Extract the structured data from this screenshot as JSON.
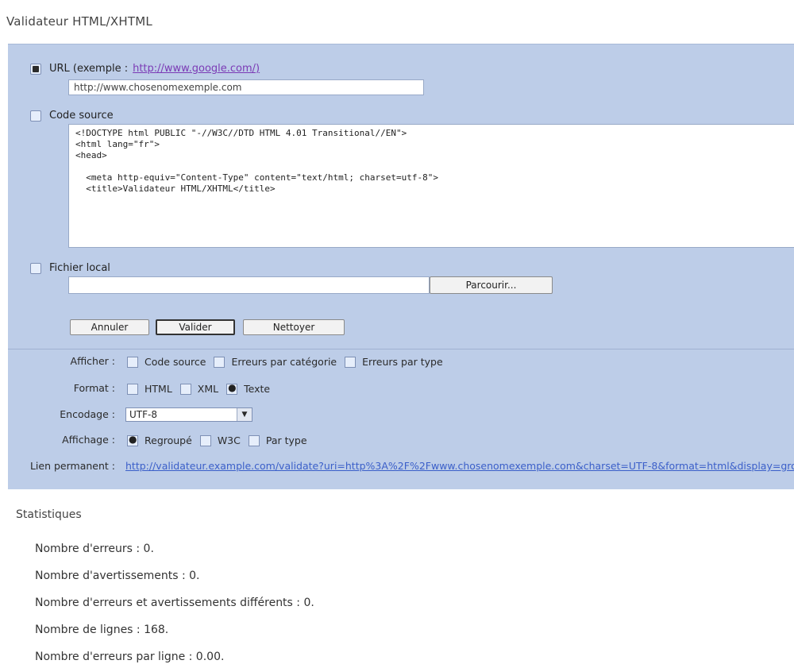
{
  "page": {
    "title": "Validateur HTML/XHTML"
  },
  "url_option": {
    "label": "URL (exemple :",
    "example_link": "http://www.google.com/)",
    "value": "http://www.chosenomexemple.com"
  },
  "source_option": {
    "label": "Code source",
    "code": "<!DOCTYPE html PUBLIC \"-//W3C//DTD HTML 4.01 Transitional//EN\">\n<html lang=\"fr\">\n<head>\n\n  <meta http-equiv=\"Content-Type\" content=\"text/html; charset=utf-8\">\n  <title>Validateur HTML/XHTML</title>"
  },
  "file_option": {
    "label": "Fichier local",
    "browse_label": "Parcourir..."
  },
  "buttons": {
    "cancel": "Annuler",
    "validate": "Valider",
    "clean": "Nettoyer"
  },
  "options": {
    "display_label": "Afficher :",
    "display_items": [
      "Code source",
      "Erreurs par catégorie",
      "Erreurs par type"
    ],
    "format_label": "Format :",
    "format_items": [
      "HTML",
      "XML",
      "Texte"
    ],
    "encoding_label": "Encodage :",
    "encoding_value": "UTF-8",
    "output_label": "Affichage :",
    "output_items": [
      "Regroupé",
      "W3C",
      "Par type"
    ],
    "permalink_label": "Lien permanent :",
    "permalink_value": "http://validateur.example.com/validate?uri=http%3A%2F%2Fwww.chosenomexemple.com&charset=UTF-8&format=html&display=group"
  },
  "stats": {
    "title": "Statistiques",
    "lines": [
      "Nombre d'erreurs : 0.",
      "Nombre d'avertissements : 0.",
      "Nombre d'erreurs et avertissements différents : 0.",
      "Nombre de lignes : 168.",
      "Nombre d'erreurs par ligne : 0.00."
    ]
  }
}
